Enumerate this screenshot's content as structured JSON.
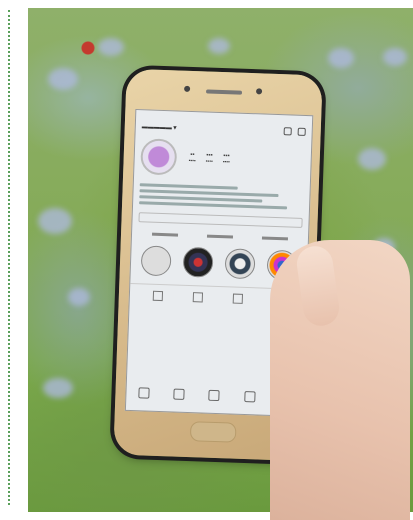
{
  "image": {
    "description_icons": [
      "phone-icon",
      "hand-icon"
    ]
  }
}
